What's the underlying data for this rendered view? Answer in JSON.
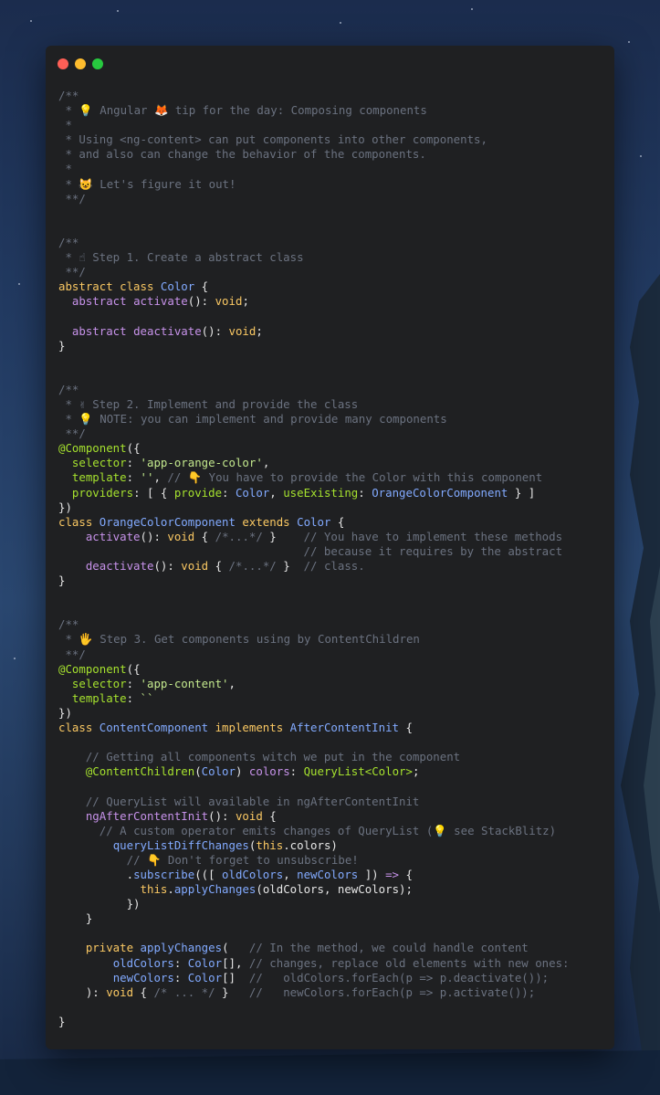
{
  "theme": {
    "background": "#1f2022",
    "comment": "#6b7280",
    "keyword": "#fac863",
    "decl": "#c792ea",
    "class": "#82aaff",
    "type": "#a6e22e",
    "string": "#c3e88d",
    "plain": "#e6e6e6"
  },
  "window": {
    "controls": [
      "close-button",
      "minimize-button",
      "maximize-button"
    ]
  },
  "code": {
    "lines": [
      [
        [
          "comment",
          "/**"
        ]
      ],
      [
        [
          "comment",
          " * 💡 Angular 🦊 tip for the day: Composing components"
        ]
      ],
      [
        [
          "comment",
          " *"
        ]
      ],
      [
        [
          "comment",
          " * Using <ng-content> can put components into other components,"
        ]
      ],
      [
        [
          "comment",
          " * and also can change the behavior of the components."
        ]
      ],
      [
        [
          "comment",
          " *"
        ]
      ],
      [
        [
          "comment",
          " * 😺 Let's figure it out!"
        ]
      ],
      [
        [
          "comment",
          " **/"
        ]
      ],
      [],
      [],
      [
        [
          "comment",
          "/**"
        ]
      ],
      [
        [
          "comment",
          " * ☝ Step 1. Create a abstract class"
        ]
      ],
      [
        [
          "comment",
          " **/"
        ]
      ],
      [
        [
          "keyword",
          "abstract class "
        ],
        [
          "class",
          "Color"
        ],
        [
          "plain",
          " {"
        ]
      ],
      [
        [
          "plain",
          "  "
        ],
        [
          "decl",
          "abstract "
        ],
        [
          "func",
          "activate"
        ],
        [
          "plain",
          "(): "
        ],
        [
          "keyword",
          "void"
        ],
        [
          "plain",
          ";"
        ]
      ],
      [],
      [
        [
          "plain",
          "  "
        ],
        [
          "decl",
          "abstract "
        ],
        [
          "func",
          "deactivate"
        ],
        [
          "plain",
          "(): "
        ],
        [
          "keyword",
          "void"
        ],
        [
          "plain",
          ";"
        ]
      ],
      [
        [
          "plain",
          "}"
        ]
      ],
      [],
      [],
      [
        [
          "comment",
          "/**"
        ]
      ],
      [
        [
          "comment",
          " * ✌ Step 2. Implement and provide the class"
        ]
      ],
      [
        [
          "comment",
          " * 💡 NOTE: you can implement and provide many components"
        ]
      ],
      [
        [
          "comment",
          " **/"
        ]
      ],
      [
        [
          "type",
          "@Component"
        ],
        [
          "plain",
          "({"
        ]
      ],
      [
        [
          "plain",
          "  "
        ],
        [
          "type",
          "selector"
        ],
        [
          "plain",
          ": "
        ],
        [
          "string",
          "'app-orange-color'"
        ],
        [
          "plain",
          ","
        ]
      ],
      [
        [
          "plain",
          "  "
        ],
        [
          "type",
          "template"
        ],
        [
          "plain",
          ": "
        ],
        [
          "string",
          "''"
        ],
        [
          "plain",
          ", "
        ],
        [
          "comment",
          "// 👇 You have to provide the Color with this component"
        ]
      ],
      [
        [
          "plain",
          "  "
        ],
        [
          "type",
          "providers"
        ],
        [
          "plain",
          ": [ { "
        ],
        [
          "type",
          "provide"
        ],
        [
          "plain",
          ": "
        ],
        [
          "class",
          "Color"
        ],
        [
          "plain",
          ", "
        ],
        [
          "type",
          "useExisting"
        ],
        [
          "plain",
          ": "
        ],
        [
          "class",
          "OrangeColorComponent"
        ],
        [
          "plain",
          " } ]"
        ]
      ],
      [
        [
          "plain",
          "})"
        ]
      ],
      [
        [
          "keyword",
          "class "
        ],
        [
          "class",
          "OrangeColorComponent "
        ],
        [
          "keyword",
          "extends "
        ],
        [
          "class",
          "Color"
        ],
        [
          "plain",
          " {"
        ]
      ],
      [
        [
          "plain",
          "    "
        ],
        [
          "func",
          "activate"
        ],
        [
          "plain",
          "(): "
        ],
        [
          "keyword",
          "void"
        ],
        [
          "plain",
          " { "
        ],
        [
          "comment",
          "/*...*/"
        ],
        [
          "plain",
          " }    "
        ],
        [
          "comment",
          "// You have to implement these methods"
        ]
      ],
      [
        [
          "comment",
          "                                    // because it requires by the abstract"
        ]
      ],
      [
        [
          "plain",
          "    "
        ],
        [
          "func",
          "deactivate"
        ],
        [
          "plain",
          "(): "
        ],
        [
          "keyword",
          "void"
        ],
        [
          "plain",
          " { "
        ],
        [
          "comment",
          "/*...*/"
        ],
        [
          "plain",
          " }  "
        ],
        [
          "comment",
          "// class."
        ]
      ],
      [
        [
          "plain",
          "}"
        ]
      ],
      [],
      [],
      [
        [
          "comment",
          "/**"
        ]
      ],
      [
        [
          "comment",
          " * 🖐 Step 3. Get components using by ContentChildren"
        ]
      ],
      [
        [
          "comment",
          " **/"
        ]
      ],
      [
        [
          "type",
          "@Component"
        ],
        [
          "plain",
          "({"
        ]
      ],
      [
        [
          "plain",
          "  "
        ],
        [
          "type",
          "selector"
        ],
        [
          "plain",
          ": "
        ],
        [
          "string",
          "'app-content'"
        ],
        [
          "plain",
          ","
        ]
      ],
      [
        [
          "plain",
          "  "
        ],
        [
          "type",
          "template"
        ],
        [
          "plain",
          ": "
        ],
        [
          "string",
          "``"
        ]
      ],
      [
        [
          "plain",
          "})"
        ]
      ],
      [
        [
          "keyword",
          "class "
        ],
        [
          "class",
          "ContentComponent "
        ],
        [
          "keyword",
          "implements "
        ],
        [
          "class",
          "AfterContentInit"
        ],
        [
          "plain",
          " {"
        ]
      ],
      [],
      [
        [
          "plain",
          "    "
        ],
        [
          "comment",
          "// Getting all components witch we put in the component"
        ]
      ],
      [
        [
          "plain",
          "    "
        ],
        [
          "type",
          "@ContentChildren"
        ],
        [
          "plain",
          "("
        ],
        [
          "class",
          "Color"
        ],
        [
          "plain",
          ") "
        ],
        [
          "decl",
          "colors"
        ],
        [
          "plain",
          ": "
        ],
        [
          "type",
          "QueryList<Color>"
        ],
        [
          "plain",
          ";"
        ]
      ],
      [],
      [
        [
          "plain",
          "    "
        ],
        [
          "comment",
          "// QueryList will available in ngAfterContentInit"
        ]
      ],
      [
        [
          "plain",
          "    "
        ],
        [
          "func",
          "ngAfterContentInit"
        ],
        [
          "plain",
          "(): "
        ],
        [
          "keyword",
          "void"
        ],
        [
          "plain",
          " {"
        ]
      ],
      [
        [
          "plain",
          "      "
        ],
        [
          "comment",
          "// A custom operator emits changes of QueryList (💡 see StackBlitz)"
        ]
      ],
      [
        [
          "plain",
          "        "
        ],
        [
          "ident",
          "queryListDiffChanges"
        ],
        [
          "plain",
          "("
        ],
        [
          "keyword",
          "this"
        ],
        [
          "plain",
          ".colors)"
        ]
      ],
      [
        [
          "plain",
          "          "
        ],
        [
          "comment",
          "// 👇 Don't forget to unsubscribe!"
        ]
      ],
      [
        [
          "plain",
          "          ."
        ],
        [
          "ident",
          "subscribe"
        ],
        [
          "plain",
          "(([ "
        ],
        [
          "ident",
          "oldColors"
        ],
        [
          "plain",
          ", "
        ],
        [
          "ident",
          "newColors"
        ],
        [
          "plain",
          " ]) "
        ],
        [
          "decl",
          "=>"
        ],
        [
          "plain",
          " {"
        ]
      ],
      [
        [
          "plain",
          "            "
        ],
        [
          "keyword",
          "this"
        ],
        [
          "plain",
          "."
        ],
        [
          "ident",
          "applyChanges"
        ],
        [
          "plain",
          "(oldColors, newColors);"
        ]
      ],
      [
        [
          "plain",
          "          })"
        ]
      ],
      [
        [
          "plain",
          "    }"
        ]
      ],
      [],
      [
        [
          "plain",
          "    "
        ],
        [
          "keyword",
          "private "
        ],
        [
          "ident",
          "applyChanges"
        ],
        [
          "plain",
          "(   "
        ],
        [
          "comment",
          "// In the method, we could handle content"
        ]
      ],
      [
        [
          "plain",
          "        "
        ],
        [
          "ident",
          "oldColors"
        ],
        [
          "plain",
          ": "
        ],
        [
          "class",
          "Color"
        ],
        [
          "plain",
          "[], "
        ],
        [
          "comment",
          "// changes, replace old elements with new ones:"
        ]
      ],
      [
        [
          "plain",
          "        "
        ],
        [
          "ident",
          "newColors"
        ],
        [
          "plain",
          ": "
        ],
        [
          "class",
          "Color"
        ],
        [
          "plain",
          "[]  "
        ],
        [
          "comment",
          "//   oldColors.forEach(p => p.deactivate());"
        ]
      ],
      [
        [
          "plain",
          "    ): "
        ],
        [
          "keyword",
          "void"
        ],
        [
          "plain",
          " { "
        ],
        [
          "comment",
          "/* ... */"
        ],
        [
          "plain",
          " }   "
        ],
        [
          "comment",
          "//   newColors.forEach(p => p.activate());"
        ]
      ],
      [],
      [
        [
          "plain",
          "}"
        ]
      ]
    ]
  }
}
